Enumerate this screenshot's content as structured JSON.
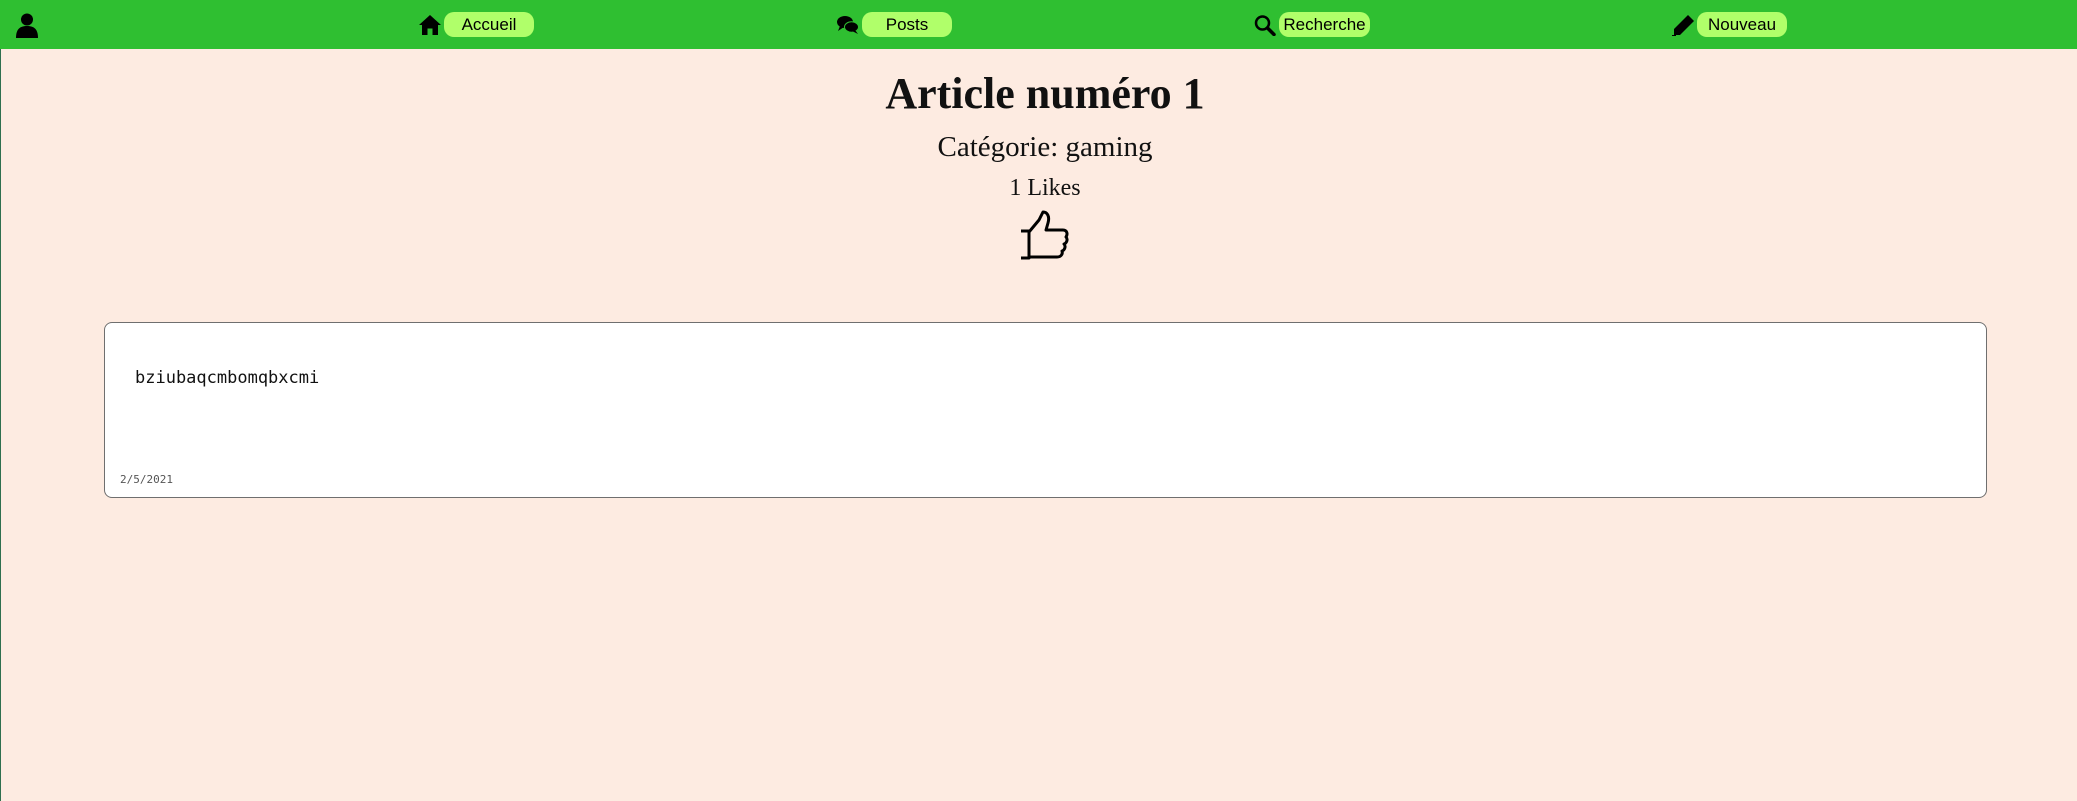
{
  "nav": {
    "user_icon": "user-icon",
    "items": [
      {
        "label": "Accueil",
        "icon": "home-icon"
      },
      {
        "label": "Posts",
        "icon": "chat-icon"
      },
      {
        "label": "Recherche",
        "icon": "search-icon"
      },
      {
        "label": "Nouveau",
        "icon": "pencil-icon"
      }
    ],
    "bar_color": "#2fbf31",
    "pill_color": "#b0ff6a"
  },
  "article": {
    "title": "Article numéro 1",
    "category": "Catégorie: gaming",
    "likes": "1 Likes",
    "like_icon": "thumbs-up-icon",
    "content": "bziubaqcmbomqbxcmi",
    "date": "2/5/2021"
  },
  "colors": {
    "background": "#fdebe1",
    "card_background": "#ffffff"
  }
}
